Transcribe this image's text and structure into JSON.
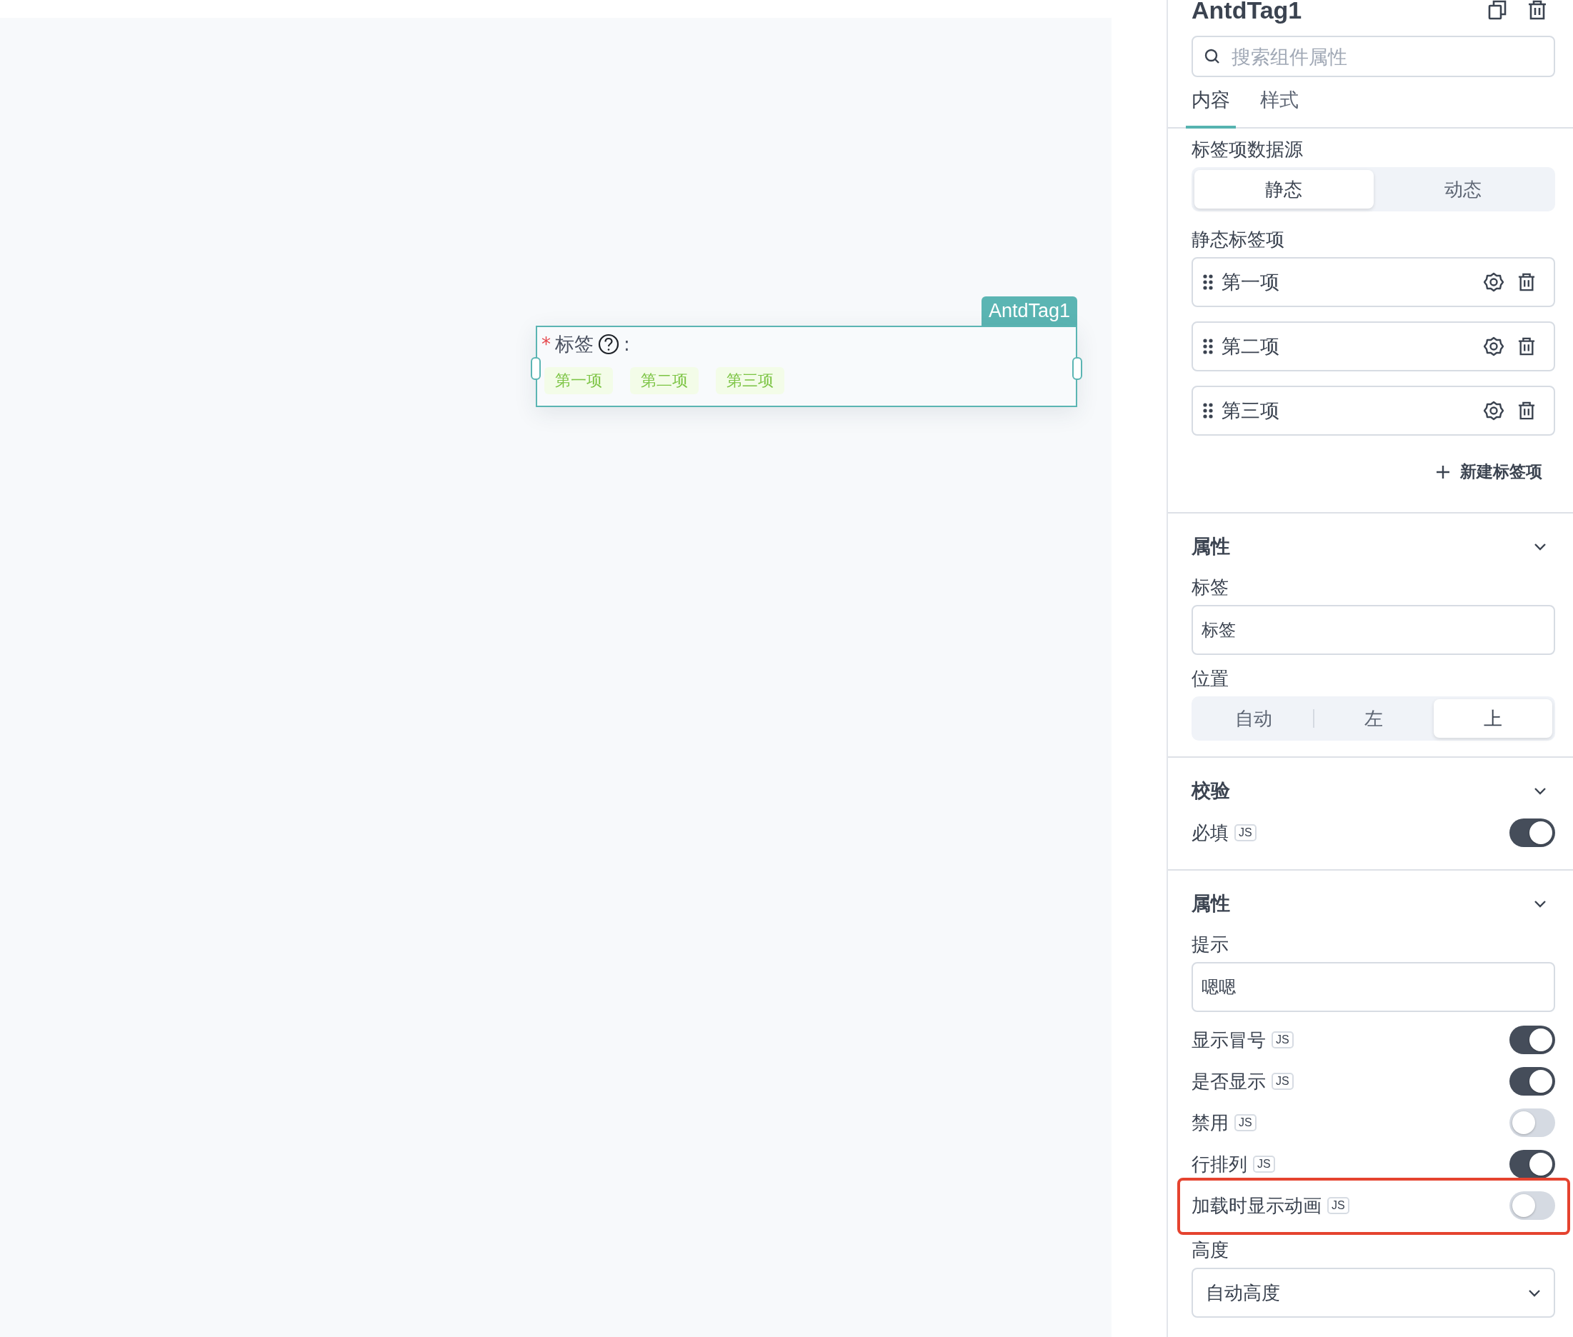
{
  "canvas": {
    "widget": {
      "name_tag": "AntdTag1",
      "required_mark": "*",
      "label": "标签",
      "colon": ":",
      "tags": [
        {
          "text": "第一项"
        },
        {
          "text": "第二项"
        },
        {
          "text": "第三项"
        }
      ]
    }
  },
  "panel": {
    "title": "AntdTag1",
    "search": {
      "placeholder": "搜索组件属性"
    },
    "tabs": [
      {
        "label": "内容",
        "selected": true
      },
      {
        "label": "样式",
        "selected": false
      }
    ],
    "content": {
      "source": {
        "label": "标签项数据源",
        "options": [
          {
            "label": "静态",
            "selected": true
          },
          {
            "label": "动态",
            "selected": false
          }
        ]
      },
      "static_items": {
        "label": "静态标签项",
        "items": [
          {
            "text": "第一项"
          },
          {
            "text": "第二项"
          },
          {
            "text": "第三项"
          }
        ],
        "add_button": "新建标签项"
      }
    },
    "sections": [
      {
        "title": "属性",
        "fields": [
          {
            "kind": "input",
            "label": "标签",
            "value": "标签"
          },
          {
            "kind": "segmented",
            "label": "位置",
            "options": [
              {
                "label": "自动",
                "selected": false
              },
              {
                "label": "左",
                "selected": false
              },
              {
                "label": "上",
                "selected": true
              }
            ]
          }
        ]
      },
      {
        "title": "校验",
        "fields": [
          {
            "kind": "toggle",
            "label": "必填",
            "badge": "JS",
            "on": true,
            "highlighted": false
          }
        ]
      },
      {
        "title": "属性",
        "fields": [
          {
            "kind": "input",
            "label": "提示",
            "value": "嗯嗯"
          },
          {
            "kind": "toggle",
            "label": "显示冒号",
            "badge": "JS",
            "on": true,
            "highlighted": false
          },
          {
            "kind": "toggle",
            "label": "是否显示",
            "badge": "JS",
            "on": true,
            "highlighted": false
          },
          {
            "kind": "toggle",
            "label": "禁用",
            "badge": "JS",
            "on": false,
            "highlighted": false
          },
          {
            "kind": "toggle",
            "label": "行排列",
            "badge": "JS",
            "on": true,
            "highlighted": false
          },
          {
            "kind": "toggle",
            "label": "加载时显示动画",
            "badge": "JS",
            "on": false,
            "highlighted": true
          },
          {
            "kind": "select",
            "label": "高度",
            "value": "自动高度"
          }
        ]
      }
    ]
  }
}
